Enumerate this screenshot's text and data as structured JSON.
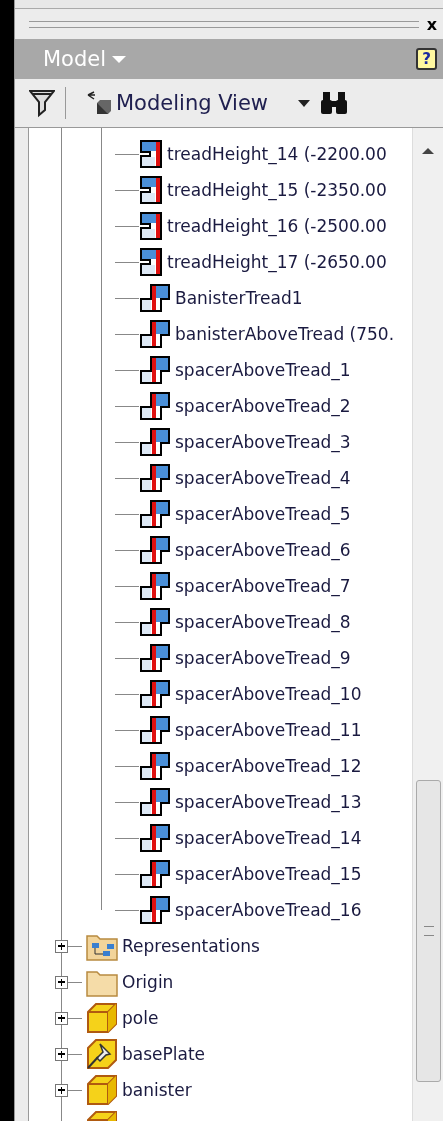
{
  "panel": {
    "close_glyph": "x"
  },
  "header": {
    "title": "Model",
    "help_glyph": "?"
  },
  "toolbar": {
    "view_label": "Modeling View"
  },
  "tree": {
    "items": [
      {
        "children": [
          {
            "kind": "parameter",
            "label": "treadHeight_14 (-2200.00"
          },
          {
            "kind": "parameter",
            "label": "treadHeight_15 (-2350.00"
          },
          {
            "kind": "parameter",
            "label": "treadHeight_16 (-2500.00"
          },
          {
            "kind": "parameter",
            "label": "treadHeight_17 (-2650.00"
          },
          {
            "kind": "step",
            "label": "BanisterTread1"
          },
          {
            "kind": "step",
            "label": "banisterAboveTread (750."
          },
          {
            "kind": "step",
            "label": "spacerAboveTread_1"
          },
          {
            "kind": "step",
            "label": "spacerAboveTread_2"
          },
          {
            "kind": "step",
            "label": "spacerAboveTread_3"
          },
          {
            "kind": "step",
            "label": "spacerAboveTread_4"
          },
          {
            "kind": "step",
            "label": "spacerAboveTread_5"
          },
          {
            "kind": "step",
            "label": "spacerAboveTread_6"
          },
          {
            "kind": "step",
            "label": "spacerAboveTread_7"
          },
          {
            "kind": "step",
            "label": "spacerAboveTread_8"
          },
          {
            "kind": "step",
            "label": "spacerAboveTread_9"
          },
          {
            "kind": "step",
            "label": "spacerAboveTread_10"
          },
          {
            "kind": "step",
            "label": "spacerAboveTread_11"
          },
          {
            "kind": "step",
            "label": "spacerAboveTread_12"
          },
          {
            "kind": "step",
            "label": "spacerAboveTread_13"
          },
          {
            "kind": "step",
            "label": "spacerAboveTread_14"
          },
          {
            "kind": "step",
            "label": "spacerAboveTread_15"
          },
          {
            "kind": "step",
            "label": "spacerAboveTread_16"
          }
        ]
      },
      {
        "kind": "representations",
        "label": "Representations",
        "expanded": false
      },
      {
        "kind": "folder",
        "label": "Origin",
        "expanded": false
      },
      {
        "kind": "part",
        "label": "pole",
        "expanded": false
      },
      {
        "kind": "grounded_part",
        "label": "basePlate",
        "expanded": false
      },
      {
        "kind": "part",
        "label": "banister",
        "expanded": false
      },
      {
        "kind": "part"
      }
    ]
  }
}
